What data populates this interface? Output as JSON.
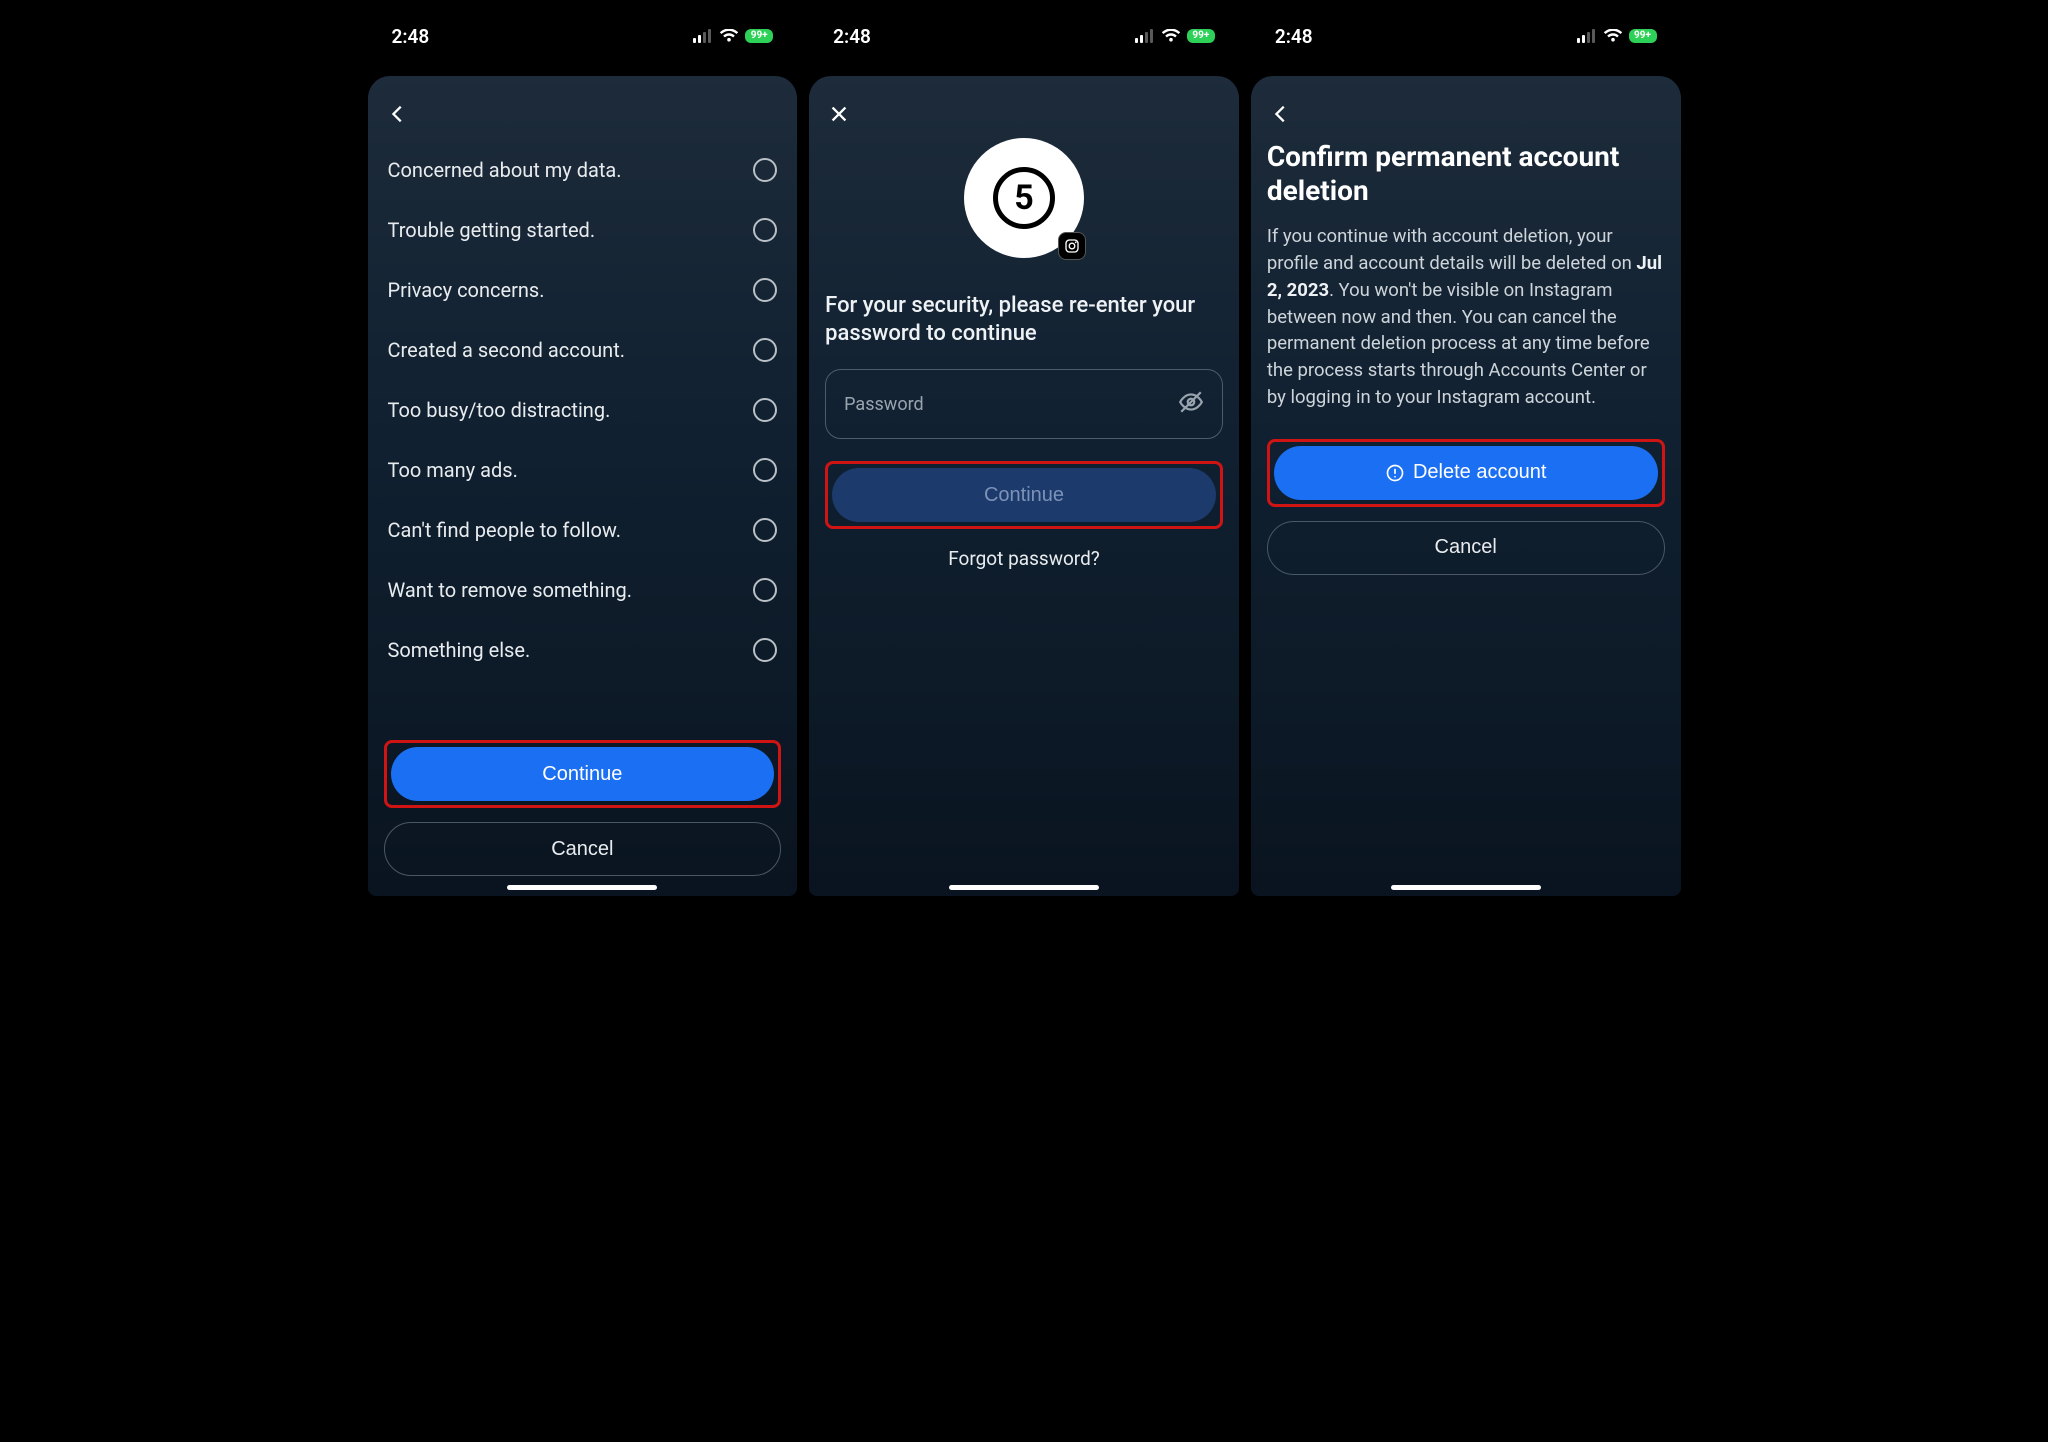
{
  "status": {
    "time": "2:48",
    "battery": "99+"
  },
  "screen1": {
    "options": [
      "Concerned about my data.",
      "Trouble getting started.",
      "Privacy concerns.",
      "Created a second account.",
      "Too busy/too distracting.",
      "Too many ads.",
      "Can't find people to follow.",
      "Want to remove something.",
      "Something else."
    ],
    "continue": "Continue",
    "cancel": "Cancel"
  },
  "screen2": {
    "avatar_text": "5",
    "heading": "For your security, please re-enter your password to continue",
    "password_placeholder": "Password",
    "continue": "Continue",
    "forgot": "Forgot password?"
  },
  "screen3": {
    "title": "Confirm permanent account deletion",
    "body_pre": "If you continue with account deletion, your profile and account details will be deleted on ",
    "body_date": "Jul 2, 2023",
    "body_post": ". You won't be visible on Instagram between now and then. You can cancel the permanent deletion process at any time before the process starts through Accounts Center or by logging in to your Instagram account.",
    "delete": "Delete account",
    "cancel": "Cancel"
  }
}
